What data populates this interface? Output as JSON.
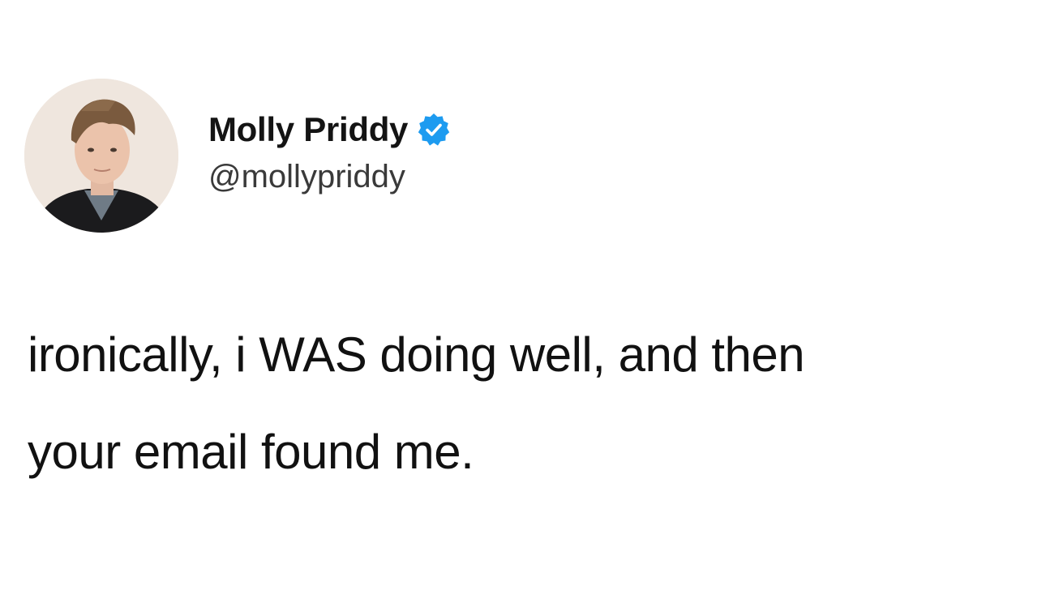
{
  "tweet": {
    "author": {
      "display_name": "Molly Priddy",
      "handle": "@mollypriddy",
      "verified": true,
      "verified_color": "#1d9bf0"
    },
    "text_lines": [
      "ironically, i WAS doing well, and then",
      "your email found me."
    ]
  },
  "icons": {
    "avatar": "profile-photo",
    "verified": "verified-badge-icon"
  }
}
